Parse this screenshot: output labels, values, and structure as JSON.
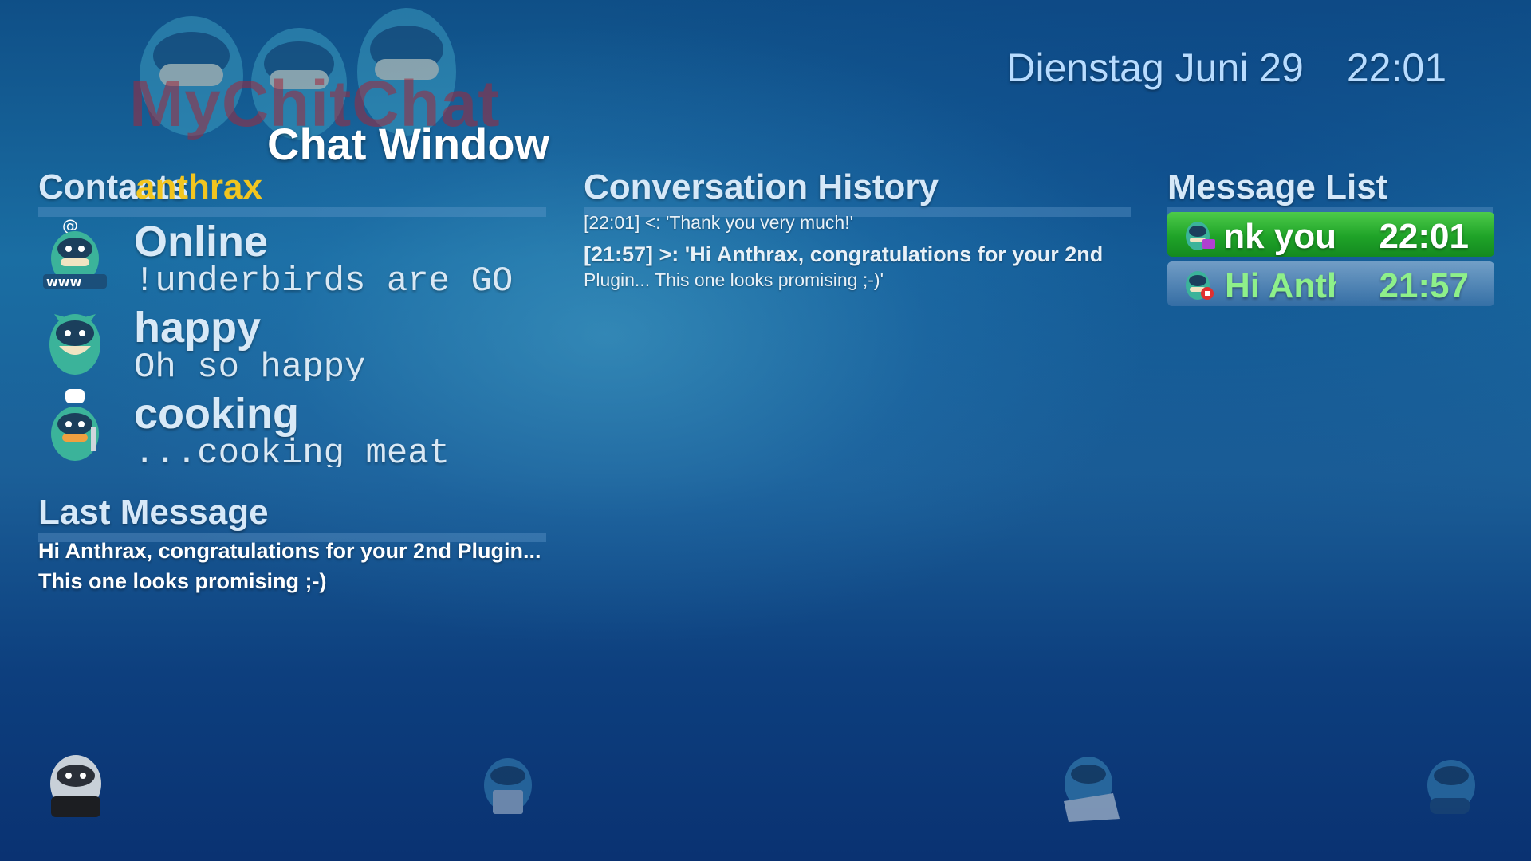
{
  "header": {
    "logo_text": "MyChitChat",
    "window_title": "Chat Window",
    "date": "Dienstag Juni 29",
    "time": "22:01"
  },
  "contacts": {
    "title": "Contacts",
    "overlay_name": "anthrax",
    "items": [
      {
        "name": "Online",
        "status": "underbirds are GO!",
        "icon": "www-mascot-icon"
      },
      {
        "name": "happy",
        "status": "Oh so happy",
        "icon": "happy-mascot-icon"
      },
      {
        "name": "cooking",
        "status": "cooking meat...",
        "icon": "chef-mascot-icon"
      }
    ]
  },
  "last_message": {
    "title": "Last Message",
    "line1": "Hi Anthrax, congratulations for your 2nd Plugin...",
    "line2": "This one looks promising ;-)"
  },
  "history": {
    "title": "Conversation History",
    "entries": [
      {
        "line": "[22:01] <: 'Thank you very much!'"
      },
      {
        "line": "[21:57] >: 'Hi Anthrax, congratulations for your 2nd",
        "cont": "Plugin... This one looks promising ;-)'"
      }
    ]
  },
  "message_list": {
    "title": "Message List",
    "items": [
      {
        "text": "ank you",
        "time": "22:01",
        "selected": true
      },
      {
        "text": "Hi Anth",
        "time": "21:57",
        "selected": false
      }
    ]
  },
  "colors": {
    "accent_yellow": "#f2c51f",
    "selected_green": "#1fa328",
    "text_light": "#d8e9f7",
    "background_blue": "#1a6ea3"
  }
}
